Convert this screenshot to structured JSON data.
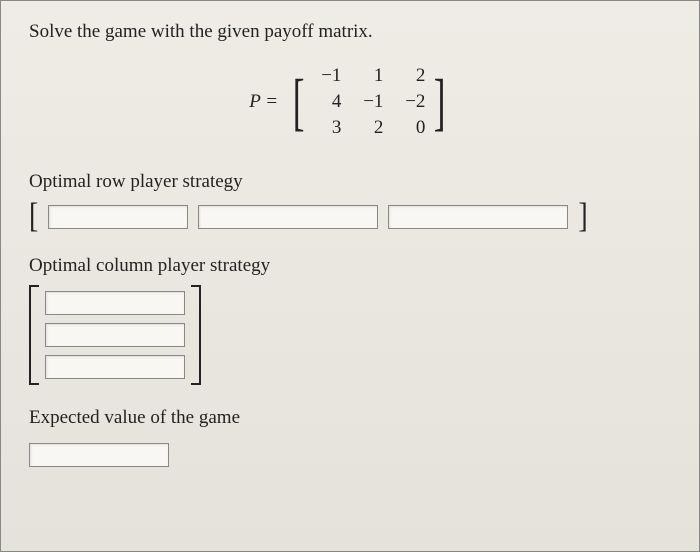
{
  "prompt": "Solve the game with the given payoff matrix.",
  "equation": {
    "label": "P =",
    "rows": [
      [
        "−1",
        "1",
        "2"
      ],
      [
        "4",
        "−1",
        "−2"
      ],
      [
        "3",
        "2",
        "0"
      ]
    ]
  },
  "row_strategy": {
    "title": "Optimal row player strategy",
    "values": [
      "",
      "",
      ""
    ]
  },
  "col_strategy": {
    "title": "Optimal column player strategy",
    "values": [
      "",
      "",
      ""
    ]
  },
  "expected_value": {
    "title": "Expected value of the game",
    "value": ""
  }
}
